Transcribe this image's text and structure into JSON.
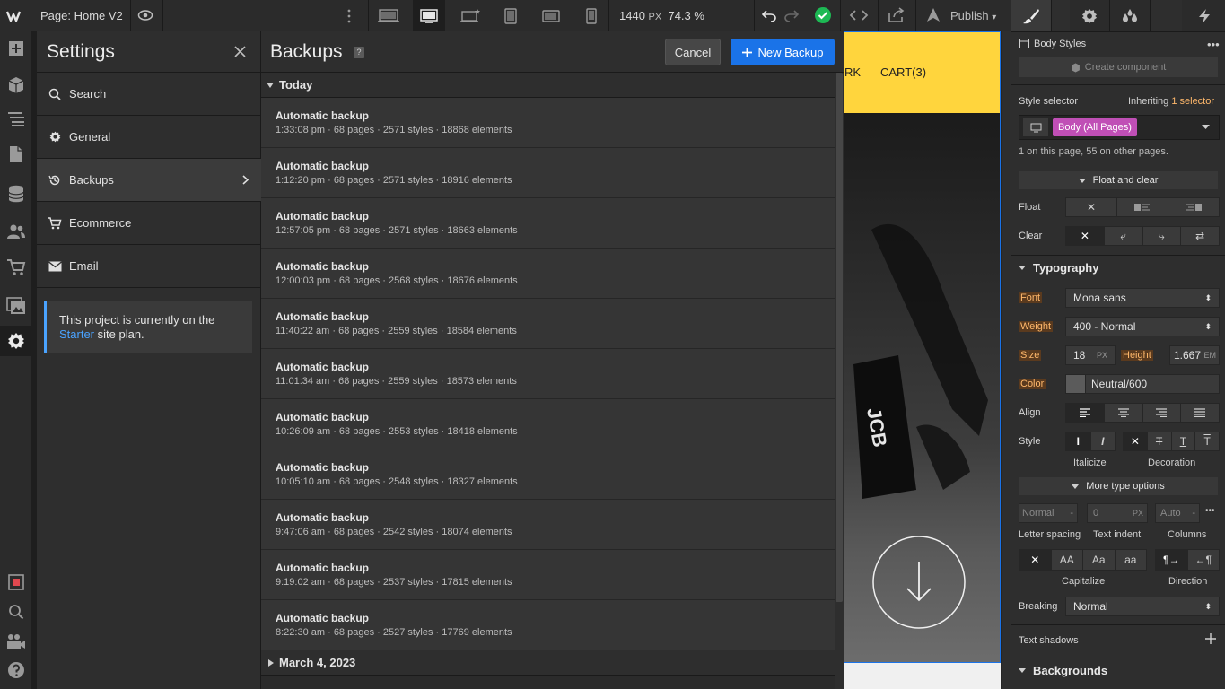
{
  "topbar": {
    "page_label": "Page: Home V2",
    "width_value": "1440",
    "width_unit": "PX",
    "zoom": "74.3 %",
    "publish_label": "Publish"
  },
  "settings": {
    "title": "Settings",
    "menu": [
      {
        "label": "Search",
        "icon": "search-icon"
      },
      {
        "label": "General",
        "icon": "gear-icon"
      },
      {
        "label": "Backups",
        "icon": "history-icon"
      },
      {
        "label": "Ecommerce",
        "icon": "cart-icon"
      },
      {
        "label": "Email",
        "icon": "mail-icon"
      }
    ],
    "notice_text": "This project is currently on the",
    "notice_link": "Starter",
    "notice_tail": "site plan."
  },
  "backups": {
    "title": "Backups",
    "help": "?",
    "cancel_label": "Cancel",
    "new_label": "New Backup",
    "group_today": "Today",
    "group_march4": "March 4, 2023",
    "items": [
      {
        "title": "Automatic backup",
        "detail": "1:33:08 pm · 68 pages · 2571 styles · 18868 elements"
      },
      {
        "title": "Automatic backup",
        "detail": "1:12:20 pm · 68 pages · 2571 styles · 18916 elements"
      },
      {
        "title": "Automatic backup",
        "detail": "12:57:05 pm · 68 pages · 2571 styles · 18663 elements"
      },
      {
        "title": "Automatic backup",
        "detail": "12:00:03 pm · 68 pages · 2568 styles · 18676 elements"
      },
      {
        "title": "Automatic backup",
        "detail": "11:40:22 am · 68 pages · 2559 styles · 18584 elements"
      },
      {
        "title": "Automatic backup",
        "detail": "11:01:34 am · 68 pages · 2559 styles · 18573 elements"
      },
      {
        "title": "Automatic backup",
        "detail": "10:26:09 am · 68 pages · 2553 styles · 18418 elements"
      },
      {
        "title": "Automatic backup",
        "detail": "10:05:10 am · 68 pages · 2548 styles · 18327 elements"
      },
      {
        "title": "Automatic backup",
        "detail": "9:47:06 am · 68 pages · 2542 styles · 18074 elements"
      },
      {
        "title": "Automatic backup",
        "detail": "9:19:02 am · 68 pages · 2537 styles · 17815 elements"
      },
      {
        "title": "Automatic backup",
        "detail": "8:22:30 am · 68 pages · 2527 styles · 17769 elements"
      }
    ]
  },
  "canvas": {
    "nav_partial": "RK",
    "cart": "CART(3)"
  },
  "rpanel": {
    "body_styles": "Body Styles",
    "create_component": "Create component",
    "style_selector": "Style selector",
    "inheriting": "Inheriting",
    "selector_link": "1 selector",
    "selector_tag": "Body (All Pages)",
    "usage": "1 on this page, 55 on other pages.",
    "float_clear": "Float and clear",
    "float_label": "Float",
    "clear_label": "Clear",
    "typography": "Typography",
    "font_label": "Font",
    "font_value": "Mona sans",
    "weight_label": "Weight",
    "weight_value": "400 - Normal",
    "size_label": "Size",
    "size_value": "18",
    "size_unit": "PX",
    "height_label": "Height",
    "height_value": "1.667",
    "height_unit": "EM",
    "color_label": "Color",
    "color_value": "Neutral/600",
    "align_label": "Align",
    "style_label": "Style",
    "italicize": "Italicize",
    "decoration": "Decoration",
    "more_type": "More type options",
    "ls_value": "Normal",
    "ti_value": "0",
    "ti_unit": "PX",
    "col_value": "Auto",
    "letter_spacing": "Letter spacing",
    "text_indent": "Text indent",
    "columns": "Columns",
    "cap_aa": "AA",
    "cap_Aa": "Aa",
    "cap_aa_lower": "aa",
    "capitalize": "Capitalize",
    "direction": "Direction",
    "breaking_label": "Breaking",
    "breaking_value": "Normal",
    "text_shadows": "Text shadows",
    "backgrounds": "Backgrounds"
  },
  "colors": {
    "accent": "#1a73e8",
    "selector_tag": "#c04fb6",
    "hero": "#ffd53d",
    "success": "#1db954"
  }
}
